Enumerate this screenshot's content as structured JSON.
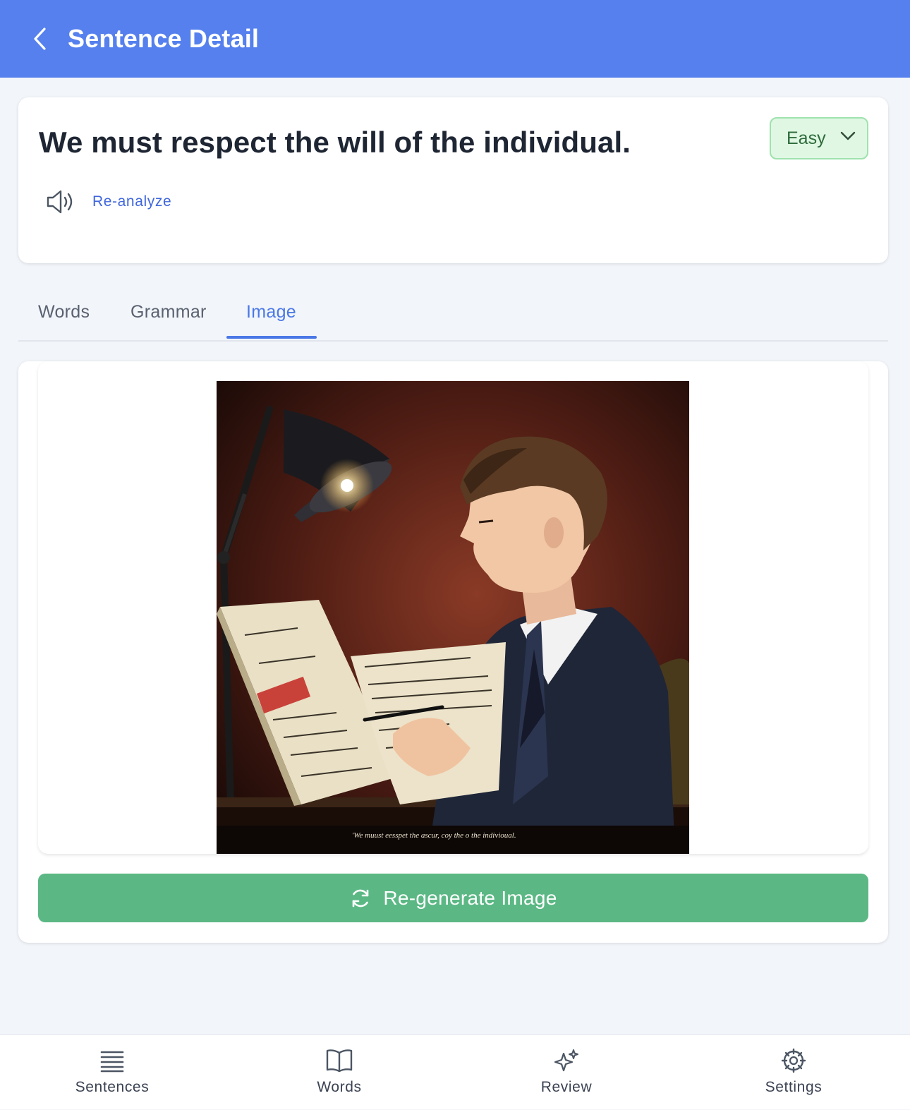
{
  "header": {
    "title": "Sentence Detail",
    "back_icon": "chevron-left-icon"
  },
  "sentence": {
    "text": "We must respect the will of the individual.",
    "difficulty": "Easy",
    "reanalyze_label": "Re-analyze",
    "speaker_icon": "speaker-icon"
  },
  "tabs": [
    {
      "label": "Words",
      "active": false
    },
    {
      "label": "Grammar",
      "active": false
    },
    {
      "label": "Image",
      "active": true
    }
  ],
  "image_panel": {
    "caption": "'We muust eesspet the ascur, coy the o the indivioual.",
    "regenerate_label": "Re-generate Image",
    "regenerate_icon": "refresh-icon"
  },
  "bottom_nav": [
    {
      "label": "Sentences",
      "icon": "list-icon"
    },
    {
      "label": "Words",
      "icon": "book-icon"
    },
    {
      "label": "Review",
      "icon": "sparkle-icon"
    },
    {
      "label": "Settings",
      "icon": "gear-icon"
    }
  ],
  "colors": {
    "header": "#5580ee",
    "accent": "#4a78e6",
    "success": "#5bb884",
    "easy_bg": "#dff7e3"
  }
}
